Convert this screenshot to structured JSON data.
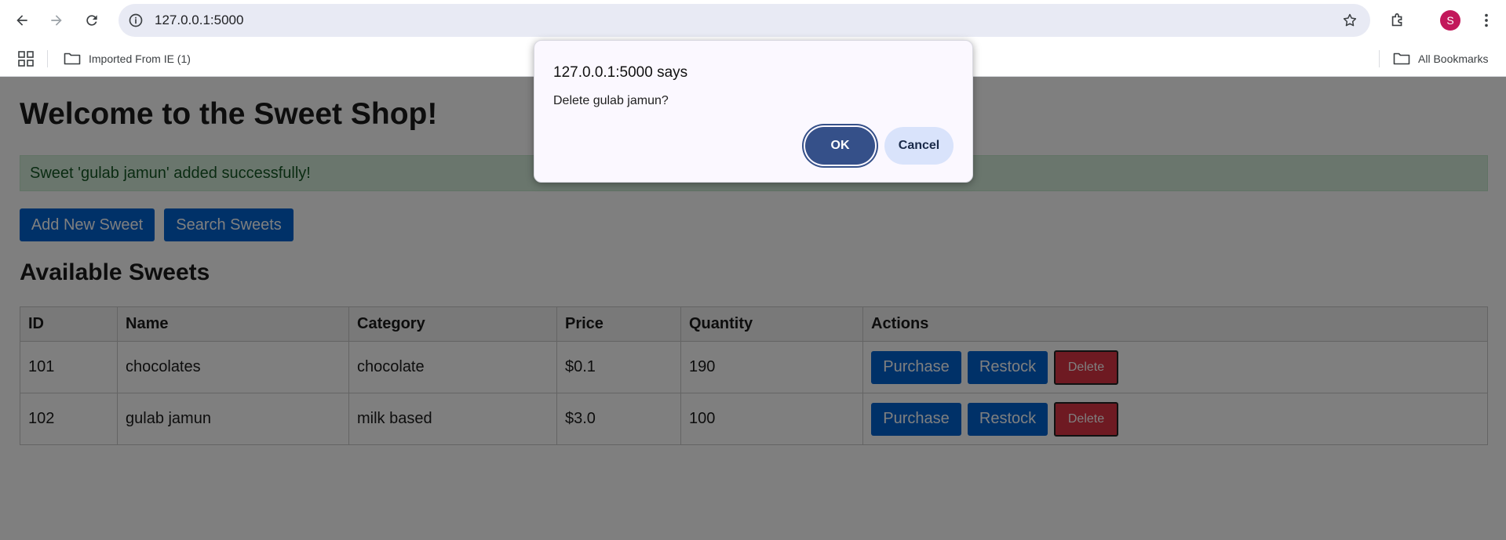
{
  "browser": {
    "url": "127.0.0.1:5000",
    "avatar_letter": "S",
    "bookmarks": [
      {
        "label": "Imported From IE (1)",
        "icon": "folder-icon"
      }
    ],
    "all_bookmarks_label": "All Bookmarks"
  },
  "page": {
    "title": "Welcome to the Sweet Shop!",
    "flash_message": "Sweet 'gulab jamun' added successfully!",
    "add_button": "Add New Sweet",
    "search_button": "Search Sweets",
    "section_title": "Available Sweets"
  },
  "table": {
    "headers": [
      "ID",
      "Name",
      "Category",
      "Price",
      "Quantity",
      "Actions"
    ],
    "rows": [
      {
        "id": "101",
        "name": "chocolates",
        "category": "chocolate",
        "price": "$0.1",
        "quantity": "190"
      },
      {
        "id": "102",
        "name": "gulab jamun",
        "category": "milk based",
        "price": "$3.0",
        "quantity": "100"
      }
    ],
    "action_labels": {
      "purchase": "Purchase",
      "restock": "Restock",
      "delete": "Delete"
    }
  },
  "dialog": {
    "title": "127.0.0.1:5000 says",
    "message": "Delete gulab jamun?",
    "ok_label": "OK",
    "cancel_label": "Cancel"
  },
  "colors": {
    "primary_button": "#0063d1",
    "delete_button": "#dc3545",
    "flash_bg": "#d4edda",
    "dialog_ok": "#355089",
    "avatar": "#c2185b"
  }
}
